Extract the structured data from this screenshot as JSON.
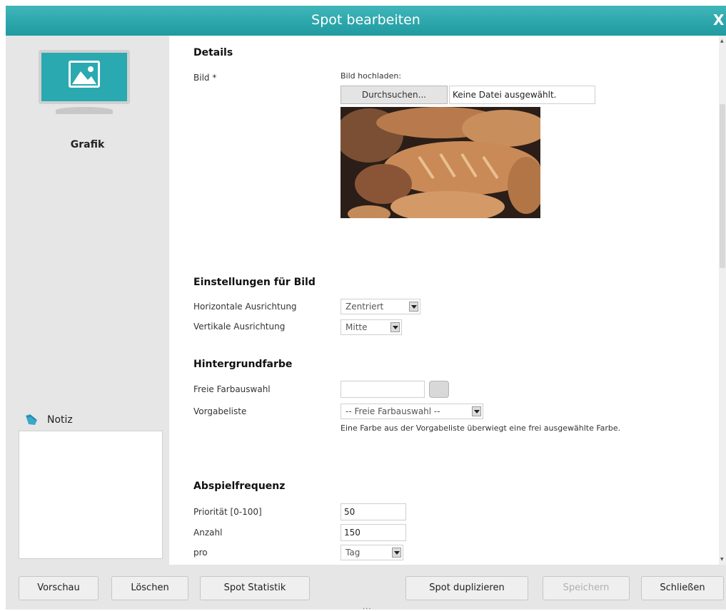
{
  "dialog": {
    "title": "Spot bearbeiten",
    "close_label": "X"
  },
  "sidebar": {
    "type_label": "Grafik",
    "notiz_label": "Notiz",
    "notiz_value": ""
  },
  "details": {
    "heading": "Details",
    "bild_label": "Bild *",
    "upload_label": "Bild hochladen:",
    "browse_button": "Durchsuchen...",
    "file_status": "Keine Datei ausgewählt."
  },
  "bild_settings": {
    "heading": "Einstellungen für Bild",
    "horizontal_label": "Horizontale Ausrichtung",
    "horizontal_value": "Zentriert",
    "vertical_label": "Vertikale Ausrichtung",
    "vertical_value": "Mitte"
  },
  "background": {
    "heading": "Hintergrundfarbe",
    "free_label": "Freie Farbauswahl",
    "free_value": "",
    "preset_label": "Vorgabeliste",
    "preset_value": "-- Freie Farbauswahl --",
    "hint": "Eine Farbe aus der Vorgabeliste überwiegt eine frei ausgewählte Farbe."
  },
  "frequency": {
    "heading": "Abspielfrequenz",
    "priority_label": "Priorität [0-100]",
    "priority_value": "50",
    "count_label": "Anzahl",
    "count_value": "150",
    "per_label": "pro",
    "per_value": "Tag"
  },
  "footer": {
    "preview": "Vorschau",
    "delete": "Löschen",
    "stats": "Spot Statistik",
    "duplicate": "Spot duplizieren",
    "save": "Speichern",
    "close": "Schließen",
    "grip": "..."
  },
  "colors": {
    "titlebar": "#2aa9b0",
    "accent": "#2aa9b0"
  }
}
